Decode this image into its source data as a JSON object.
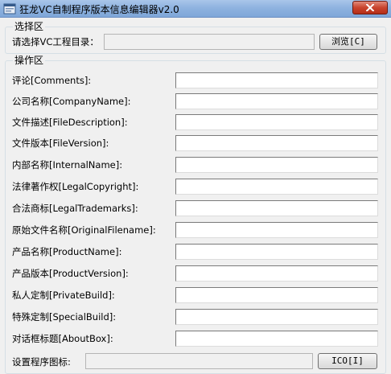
{
  "window": {
    "title": "狂龙VC自制程序版本信息编辑器v2.0",
    "colors": {
      "titlebar": "#8fb3e0",
      "close_button": "#c9442e",
      "background": "#f0f0f0"
    }
  },
  "select_group": {
    "legend": "选择区",
    "project_dir_label": "请选择VC工程目录：",
    "project_dir_value": "",
    "browse_button": "浏览[C]"
  },
  "operation_group": {
    "legend": "操作区",
    "fields": [
      {
        "label": "评论[Comments]:",
        "value": ""
      },
      {
        "label": "公司名称[CompanyName]:",
        "value": ""
      },
      {
        "label": "文件描述[FileDescription]:",
        "value": ""
      },
      {
        "label": "文件版本[FileVersion]:",
        "value": ""
      },
      {
        "label": "内部名称[InternalName]:",
        "value": ""
      },
      {
        "label": "法律著作权[LegalCopyright]:",
        "value": ""
      },
      {
        "label": "合法商标[LegalTrademarks]:",
        "value": ""
      },
      {
        "label": "原始文件名称[OriginalFilename]:",
        "value": ""
      },
      {
        "label": "产品名称[ProductName]:",
        "value": ""
      },
      {
        "label": "产品版本[ProductVersion]:",
        "value": ""
      },
      {
        "label": "私人定制[PrivateBuild]:",
        "value": ""
      },
      {
        "label": "特殊定制[SpecialBuild]:",
        "value": ""
      },
      {
        "label": "对话框标题[AboutBox]:",
        "value": ""
      }
    ],
    "icon_label": "设置程序图标:",
    "icon_value": "",
    "icon_button": "ICO[I]"
  }
}
